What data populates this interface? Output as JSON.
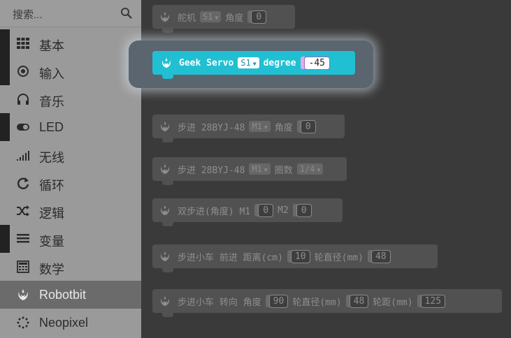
{
  "search": {
    "placeholder": "搜索..."
  },
  "categories": [
    {
      "label": "基本",
      "icon": "grid-icon",
      "color": "#1e90ff"
    },
    {
      "label": "输入",
      "icon": "radio-button-icon",
      "color": "#d400d4"
    },
    {
      "label": "音乐",
      "icon": "headphones-icon",
      "color": "#e63022"
    },
    {
      "label": "LED",
      "icon": "toggle-icon",
      "color": "#5c2d91"
    },
    {
      "label": "无线",
      "icon": "signal-bars-icon",
      "color": "#e3008c"
    },
    {
      "label": "循环",
      "icon": "refresh-icon",
      "color": "#00aa00"
    },
    {
      "label": "逻辑",
      "icon": "shuffle-icon",
      "color": "#00a4a6"
    },
    {
      "label": "变量",
      "icon": "lines-icon",
      "color": "#dc143c"
    },
    {
      "label": "数学",
      "icon": "calculator-icon",
      "color": "#9400d3"
    },
    {
      "label": "Robotbit",
      "icon": "rebel-icon",
      "color": "#05a5c0"
    },
    {
      "label": "Neopixel",
      "icon": "dotted-circle-icon",
      "color": "#2699bf"
    }
  ],
  "blocks": {
    "servo_cn": {
      "name": "舵机",
      "servo": "S1",
      "angle_label": "角度",
      "angle": "0"
    },
    "geek_servo": {
      "name": "Geek Servo",
      "servo": "S1",
      "degree_label": "degree",
      "degree": "-45"
    },
    "stepper_angle": {
      "name": "步进 28BYJ-48",
      "motor": "M1",
      "angle_label": "角度",
      "angle": "0"
    },
    "stepper_turns": {
      "name": "步进 28BYJ-48",
      "motor": "M1",
      "turns_label": "圈数",
      "turns": "1/4"
    },
    "dual_stepper": {
      "name": "双步进(角度) M1",
      "m1": "0",
      "m2_label": "M2",
      "m2": "0"
    },
    "car_forward": {
      "name": "步进小车 前进 距离(cm)",
      "distance": "10",
      "wheel_label": "轮直径(mm)",
      "wheel": "48"
    },
    "car_turn": {
      "name": "步进小车 转向 角度",
      "angle": "90",
      "wheel_label": "轮直径(mm)",
      "wheel": "48",
      "track_label": "轮距(mm)",
      "track": "125"
    }
  },
  "colors": {
    "highlight_block": "#21bfd2",
    "sidebar_bg": "#9a9a9a",
    "workspace_bg": "#3a3a3a"
  }
}
